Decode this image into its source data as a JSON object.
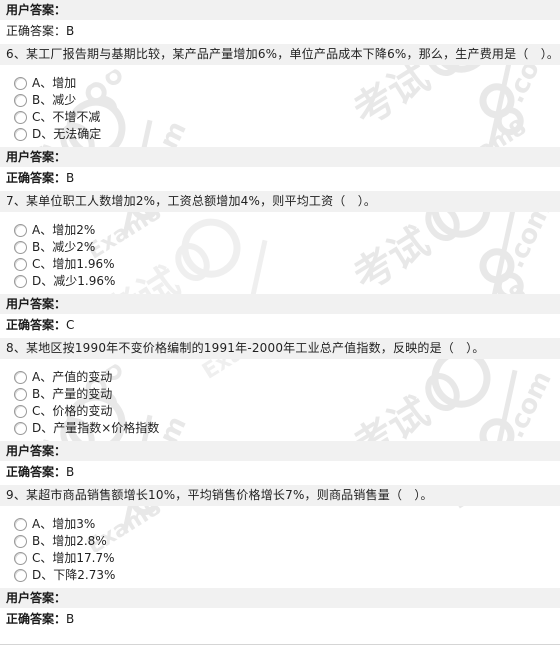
{
  "page": {
    "site_watermark": "考试吧 Exam8.com",
    "labels": {
      "user_answer": "用户答案：",
      "correct_answer_prefix": "正确答案：",
      "correct_answer_label": "正确答案"
    }
  },
  "top_partial": {
    "user_answer_label": "用户答案：",
    "user_answer_value": "",
    "correct_answer": "正确答案：B"
  },
  "questions": [
    {
      "number": "6",
      "text": "6、某工厂报告期与基期比较，某产品产量增加6%，单位产品成本下降6%，那么，生产费用是（　）。",
      "options": [
        {
          "key": "A",
          "label": "A、增加",
          "selected": false
        },
        {
          "key": "B",
          "label": "B、减少",
          "selected": false
        },
        {
          "key": "C",
          "label": "C、不增不减",
          "selected": false
        },
        {
          "key": "D",
          "label": "D、无法确定",
          "selected": false
        }
      ],
      "user_answer_label": "用户答案：",
      "user_answer_value": "",
      "correct_answer_label": "正确答案：",
      "correct_answer_value": "B"
    },
    {
      "number": "7",
      "text": "7、某单位职工人数增加2%，工资总额增加4%，则平均工资（　）。",
      "options": [
        {
          "key": "A",
          "label": "A、增加2%",
          "selected": false
        },
        {
          "key": "B",
          "label": "B、减少2%",
          "selected": false
        },
        {
          "key": "C",
          "label": "C、增加1.96%",
          "selected": false
        },
        {
          "key": "D",
          "label": "D、减少1.96%",
          "selected": false
        }
      ],
      "user_answer_label": "用户答案：",
      "user_answer_value": "",
      "correct_answer_label": "正确答案：",
      "correct_answer_value": "C"
    },
    {
      "number": "8",
      "text": "8、某地区按1990年不变价格编制的1991年-2000年工业总产值指数，反映的是（　）。",
      "options": [
        {
          "key": "A",
          "label": "A、产值的变动",
          "selected": false
        },
        {
          "key": "B",
          "label": "B、产量的变动",
          "selected": false
        },
        {
          "key": "C",
          "label": "C、价格的变动",
          "selected": false
        },
        {
          "key": "D",
          "label": "D、产量指数×价格指数",
          "selected": false
        }
      ],
      "user_answer_label": "用户答案：",
      "user_answer_value": "",
      "correct_answer_label": "正确答案：",
      "correct_answer_value": "B"
    },
    {
      "number": "9",
      "text": "9、某超市商品销售额增长10%，平均销售价格增长7%，则商品销售量（　）。",
      "options": [
        {
          "key": "A",
          "label": "A、增加3%",
          "selected": false
        },
        {
          "key": "B",
          "label": "B、增加2.8%",
          "selected": false
        },
        {
          "key": "C",
          "label": "C、增加17.7%",
          "selected": false
        },
        {
          "key": "D",
          "label": "D、下降2.73%",
          "selected": false
        }
      ],
      "user_answer_label": "用户答案：",
      "user_answer_value": "",
      "correct_answer_label": "正确答案：",
      "correct_answer_value": "B"
    }
  ],
  "colors": {
    "question_band": "#f1f1f1",
    "answer_band": "#f1f1f1",
    "page_background": "#ffffff",
    "text": "#1f1f1f",
    "watermark": "#e6e6e6",
    "divider": "#d5d5d5"
  }
}
